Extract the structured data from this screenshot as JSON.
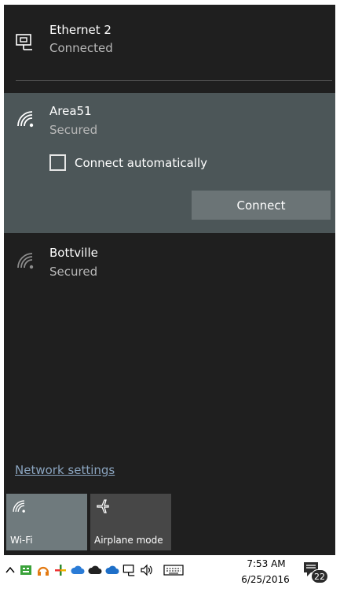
{
  "networks": {
    "ethernet": {
      "name": "Ethernet 2",
      "status": "Connected",
      "icon": "ethernet-icon"
    },
    "area51": {
      "name": "Area51",
      "status": "Secured",
      "icon": "wifi-icon"
    },
    "bottville": {
      "name": "Bottville",
      "status": "Secured",
      "icon": "wifi-icon"
    }
  },
  "connect_auto_label": "Connect automatically",
  "connect_auto_checked": false,
  "connect_button": "Connect",
  "network_settings": "Network settings",
  "tiles": {
    "wifi": {
      "label": "Wi-Fi",
      "icon": "wifi-icon",
      "active": true
    },
    "airplane": {
      "label": "Airplane mode",
      "icon": "airplane-icon",
      "active": false
    }
  },
  "taskbar": {
    "time": "7:53 AM",
    "date": "6/25/2016",
    "notification_count": "22",
    "tray_icons": [
      "chevron-up-icon",
      "app-green-icon",
      "headphones-icon",
      "plus-app-icon",
      "cloud-icon",
      "cloud-dark-icon",
      "onedrive-icon",
      "network-icon",
      "volume-icon",
      "keyboard-icon"
    ]
  },
  "colors": {
    "flyout_bg": "#1f1f1f",
    "selected_bg": "#4c5658",
    "wifi_tile_active": "#6f7a7d",
    "tile_inactive": "#474747",
    "link": "#8aa4bf"
  }
}
